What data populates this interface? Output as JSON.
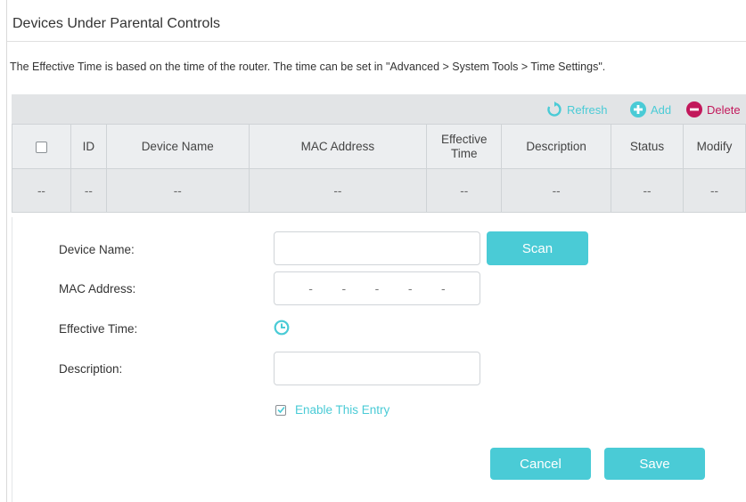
{
  "page": {
    "title": "Devices Under Parental Controls",
    "note": "The Effective Time is based on the time of the router. The time can be set in \"Advanced > System Tools > Time Settings\"."
  },
  "toolbar": {
    "refresh_label": "Refresh",
    "add_label": "Add",
    "delete_label": "Delete"
  },
  "table": {
    "headers": {
      "id": "ID",
      "device_name": "Device Name",
      "mac_address": "MAC Address",
      "effective_time": "Effective Time",
      "description": "Description",
      "status": "Status",
      "modify": "Modify"
    },
    "rows": [
      [
        "--",
        "--",
        "--",
        "--",
        "--",
        "--",
        "--",
        "--"
      ]
    ]
  },
  "form": {
    "device_name_label": "Device Name:",
    "device_name_value": "",
    "scan_label": "Scan",
    "mac_label": "MAC Address:",
    "mac_separators": [
      "-",
      "-",
      "-",
      "-",
      "-"
    ],
    "effective_time_label": "Effective Time:",
    "description_label": "Description:",
    "description_value": "",
    "enable_label": "Enable This Entry",
    "enable_checked": true,
    "cancel_label": "Cancel",
    "save_label": "Save"
  },
  "colors": {
    "accent": "#4acbd6",
    "delete": "#c2185b"
  }
}
